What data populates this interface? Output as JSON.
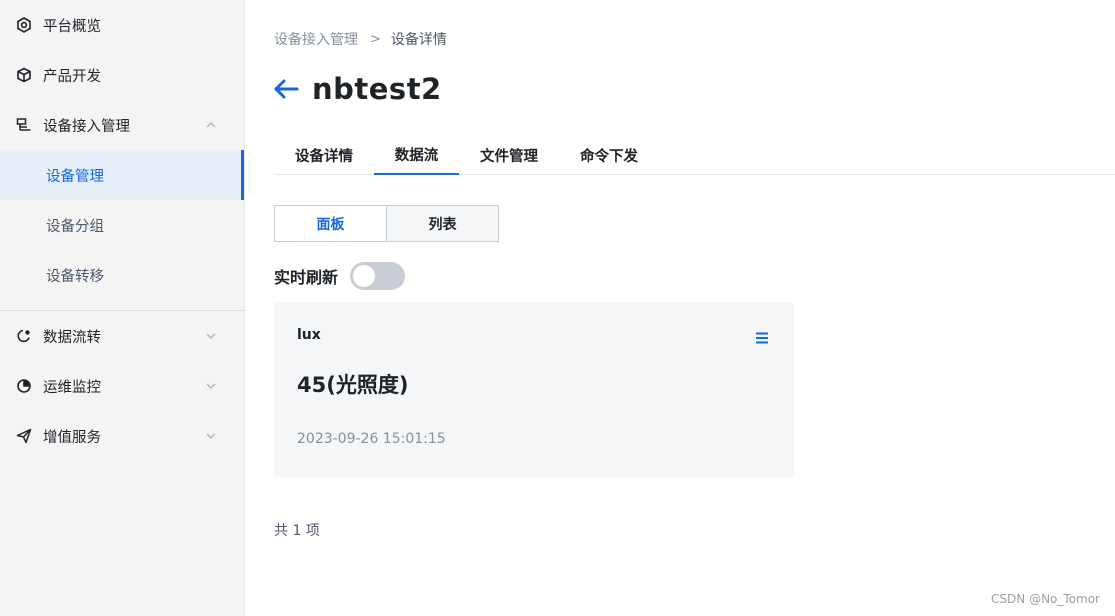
{
  "sidebar": {
    "items": [
      {
        "label": "平台概览",
        "icon": "platform-overview-icon"
      },
      {
        "label": "产品开发",
        "icon": "product-cube-icon"
      },
      {
        "label": "设备接入管理",
        "icon": "device-access-icon",
        "expanded": true,
        "children": [
          {
            "label": "设备管理",
            "active": true
          },
          {
            "label": "设备分组"
          },
          {
            "label": "设备转移"
          }
        ]
      },
      {
        "label": "数据流转",
        "icon": "data-flow-icon"
      },
      {
        "label": "运维监控",
        "icon": "ops-monitor-icon"
      },
      {
        "label": "增值服务",
        "icon": "send-plane-icon"
      }
    ]
  },
  "breadcrumb": {
    "parent": "设备接入管理",
    "separator": ">",
    "current": "设备详情"
  },
  "title": "nbtest2",
  "tabs": [
    {
      "label": "设备详情"
    },
    {
      "label": "数据流",
      "active": true
    },
    {
      "label": "文件管理"
    },
    {
      "label": "命令下发"
    }
  ],
  "view_toggle": {
    "panel": "面板",
    "list": "列表",
    "active": "面板"
  },
  "realtime_refresh": {
    "label": "实时刷新",
    "on": false
  },
  "cards": [
    {
      "name": "lux",
      "value": "45(光照度)",
      "time": "2023-09-26 15:01:15"
    }
  ],
  "total_text": "共 1 项",
  "watermark": "CSDN @No_Tomor",
  "colors": {
    "accent": "#1668dc",
    "sidebar_bg": "#f4f4f5",
    "card_bg": "#f5f6f8"
  }
}
